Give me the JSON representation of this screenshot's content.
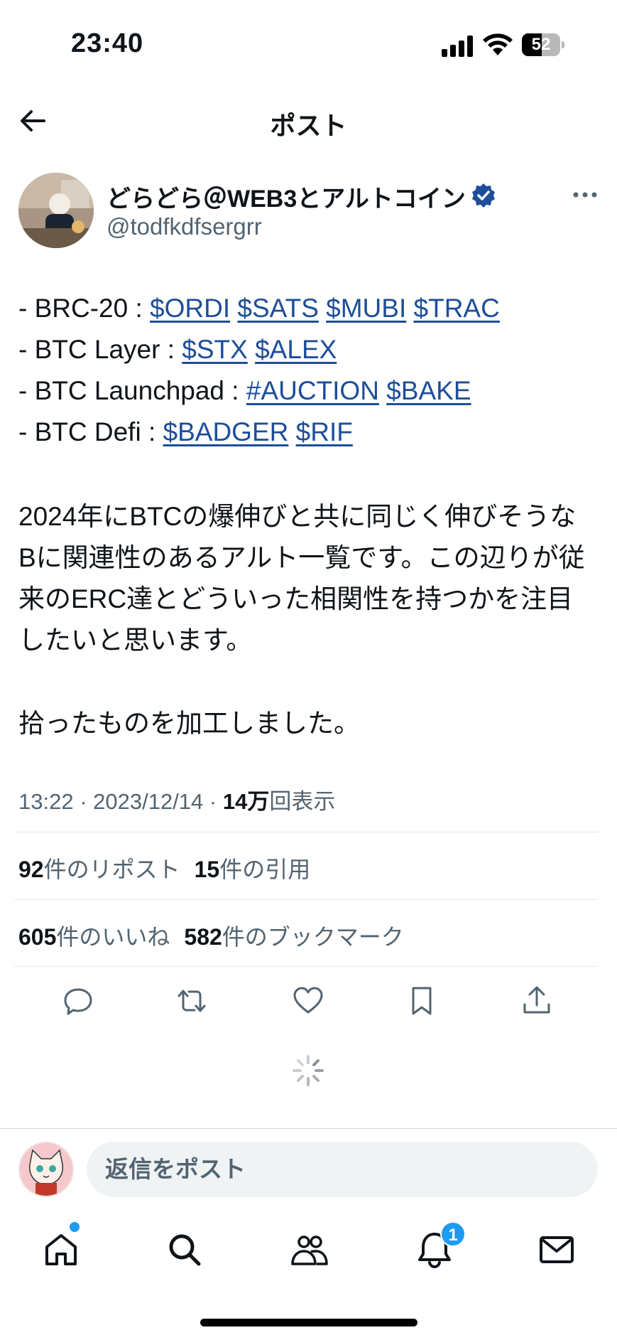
{
  "status_bar": {
    "time": "23:40",
    "battery": "52",
    "battery_level": 0.52
  },
  "header": {
    "title": "ポスト",
    "back_icon": "back-arrow-icon"
  },
  "author": {
    "name": "どらどら＠WEB3とアルトコイン",
    "handle": "@todfkdfsergrr",
    "verified": true
  },
  "tweet": {
    "token_lines": [
      {
        "label": "- BRC-20 : ",
        "tags": [
          "$ORDI",
          "$SATS",
          "$MUBI",
          "$TRAC"
        ]
      },
      {
        "label": "- BTC Layer : ",
        "tags": [
          "$STX",
          "$ALEX"
        ]
      },
      {
        "label": "- BTC Launchpad : ",
        "tags": [
          "#AUCTION",
          "$BAKE"
        ]
      },
      {
        "label": "- BTC  Defi : ",
        "tags": [
          "$BADGER",
          "$RIF"
        ]
      }
    ],
    "body_lines": [
      "2024年にBTCの爆伸びと共に同じく伸びそうな",
      "Bに関連性のあるアルト一覧です。この辺りが従",
      "来のERC達とどういった相関性を持つかを注目",
      "したいと思います。"
    ],
    "body_note": "拾ったものを加工しました。"
  },
  "meta": {
    "time": "13:22",
    "sep1": " · ",
    "date": "2023/12/14",
    "sep2": " · ",
    "views_count": "14万",
    "views_label": "回表示"
  },
  "stats": {
    "reposts_count": "92",
    "reposts_label": "件のリポスト",
    "quotes_count": "15",
    "quotes_label": "件の引用",
    "likes_count": "605",
    "likes_label": "件のいいね",
    "bookmarks_count": "582",
    "bookmarks_label": "件のブックマーク"
  },
  "actions": [
    "reply-icon",
    "repost-icon",
    "like-icon",
    "bookmark-icon",
    "share-icon"
  ],
  "reply": {
    "placeholder": "返信をポスト"
  },
  "nav": {
    "items": [
      "home-icon",
      "search-icon",
      "communities-icon",
      "notifications-icon",
      "messages-icon"
    ],
    "notification_badge": "1"
  },
  "colors": {
    "link": "#1d4e98",
    "accent": "#1d9bf0",
    "muted": "#536471",
    "text": "#0f1419"
  }
}
